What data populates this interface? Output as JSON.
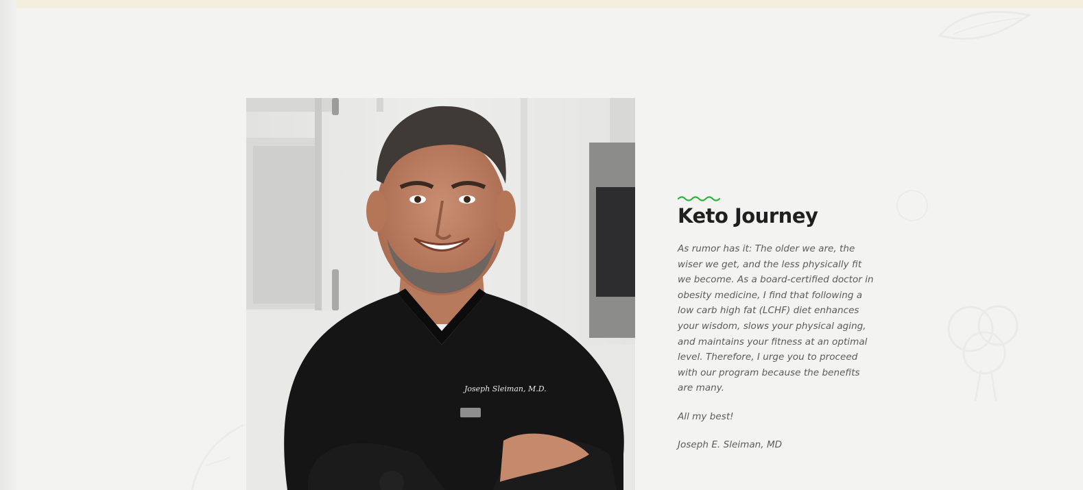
{
  "colors": {
    "background": "#f3f3f2",
    "top_band": "#f4efdc",
    "accent_green": "#2bb43a",
    "heading": "#1f1f1f",
    "body_text": "#5b5b5b"
  },
  "section": {
    "heading": "Keto Journey",
    "accent_icon": "wave-icon",
    "paragraph": "As rumor has it: The older we are, the wiser we get, and the less physically fit we become. As a board-certified doctor in obesity medicine, I find that following a low carb high fat (LCHF) diet enhances your wisdom, slows your physical aging, and maintains your fitness at an optimal level. Therefore, I urge you to proceed with our program because the benefits are many.",
    "signoff": "All my best!",
    "signature": "Joseph E. Sleiman, MD"
  },
  "photo": {
    "subject": "doctor-portrait",
    "embroidery": "Joseph Sleiman, M.D."
  }
}
